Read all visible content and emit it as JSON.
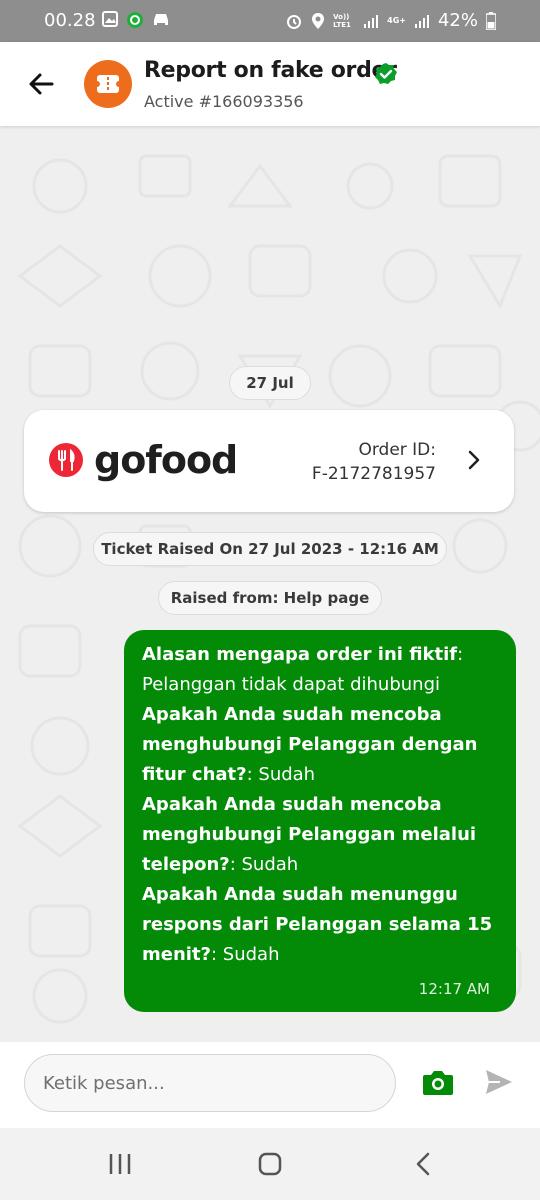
{
  "status_bar": {
    "time": "00.28",
    "battery": "42%",
    "network_left": "Vo)) LTE1",
    "network_right": "4G+"
  },
  "header": {
    "title": "Report on fake order",
    "subtitle": "Active #166093356"
  },
  "chat": {
    "date_label": "27 Jul",
    "order_card": {
      "brand": "gofood",
      "order_label": "Order ID:",
      "order_id": "F-2172781957"
    },
    "ticket_info": "Ticket Raised On 27 Jul 2023 - 12:16 AM",
    "raised_from": "Raised from: Help page",
    "message": {
      "q1": "Alasan mengapa order ini fiktif",
      "a1": "Pelanggan tidak dapat dihubungi",
      "q2": "Apakah Anda sudah mencoba menghubungi Pelanggan dengan fitur chat?",
      "a2": "Sudah",
      "q3": "Apakah Anda sudah mencoba menghubungi Pelanggan melalui telepon?",
      "a3": "Sudah",
      "q4": "Apakah Anda sudah menunggu respons dari Pelanggan selama 15 menit?",
      "a4": "Sudah",
      "time": "12:17 AM"
    }
  },
  "composer": {
    "placeholder": "Ketik pesan..."
  },
  "colors": {
    "accent_green": "#038b08",
    "avatar_orange": "#ee6d1d",
    "gofood_red": "#ee2737"
  },
  "icons": [
    "back-arrow-icon",
    "verified-check-icon",
    "chevron-right-icon",
    "camera-icon",
    "send-icon",
    "recents-icon",
    "home-icon",
    "back-nav-icon"
  ]
}
